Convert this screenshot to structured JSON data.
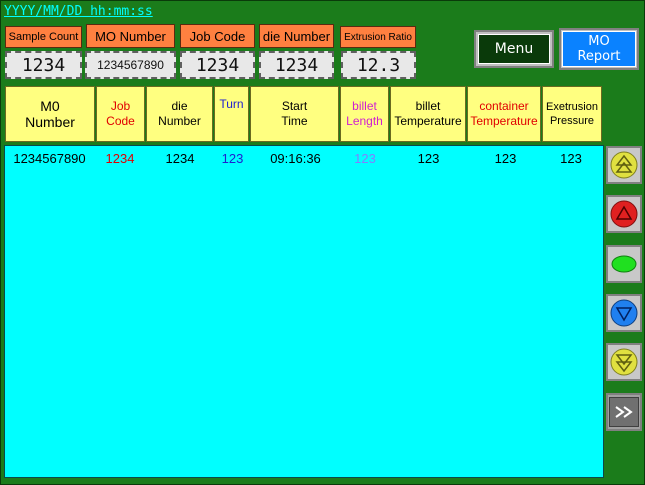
{
  "header": {
    "datetime": "YYYY/MM/DD hh:mm:ss"
  },
  "fields": [
    {
      "label": "Sample Count",
      "value": "1234"
    },
    {
      "label": "MO Number",
      "value": "1234567890"
    },
    {
      "label": "Job Code",
      "value": "1234"
    },
    {
      "label": "die Number",
      "value": "1234"
    },
    {
      "label": "Extrusion Ratio",
      "value": "12.3"
    }
  ],
  "buttons": {
    "menu": "Menu",
    "report_line1": "MO",
    "report_line2": "Report"
  },
  "columns": [
    {
      "l1": "M0",
      "l2": "Number",
      "color": "#000000"
    },
    {
      "l1": "Job",
      "l2": "Code",
      "color": "#e00000"
    },
    {
      "l1": "die",
      "l2": "Number",
      "color": "#000000"
    },
    {
      "l1": "Turn",
      "l2": "",
      "color": "#2020d0"
    },
    {
      "l1": "Start",
      "l2": "Time",
      "color": "#000000"
    },
    {
      "l1": "billet",
      "l2": "Length",
      "color": "#d020d0"
    },
    {
      "l1": "billet",
      "l2": "Temperature",
      "color": "#000000"
    },
    {
      "l1": "container",
      "l2": "Temperature",
      "color": "#e00000"
    },
    {
      "l1": "Exetrusion",
      "l2": "Pressure",
      "color": "#000000"
    }
  ],
  "rows": [
    [
      "1234567890",
      "1234",
      "1234",
      "123",
      "09:16:36",
      "123",
      "123",
      "123",
      "123"
    ]
  ],
  "side_buttons": [
    "page-up-icon",
    "up-icon",
    "stop-icon",
    "down-icon",
    "page-down-icon",
    "fast-forward-icon"
  ],
  "colors": {
    "background": "#1b7c1b",
    "label": "#ff8040",
    "table": "#00ffff",
    "header": "#ffff80"
  }
}
